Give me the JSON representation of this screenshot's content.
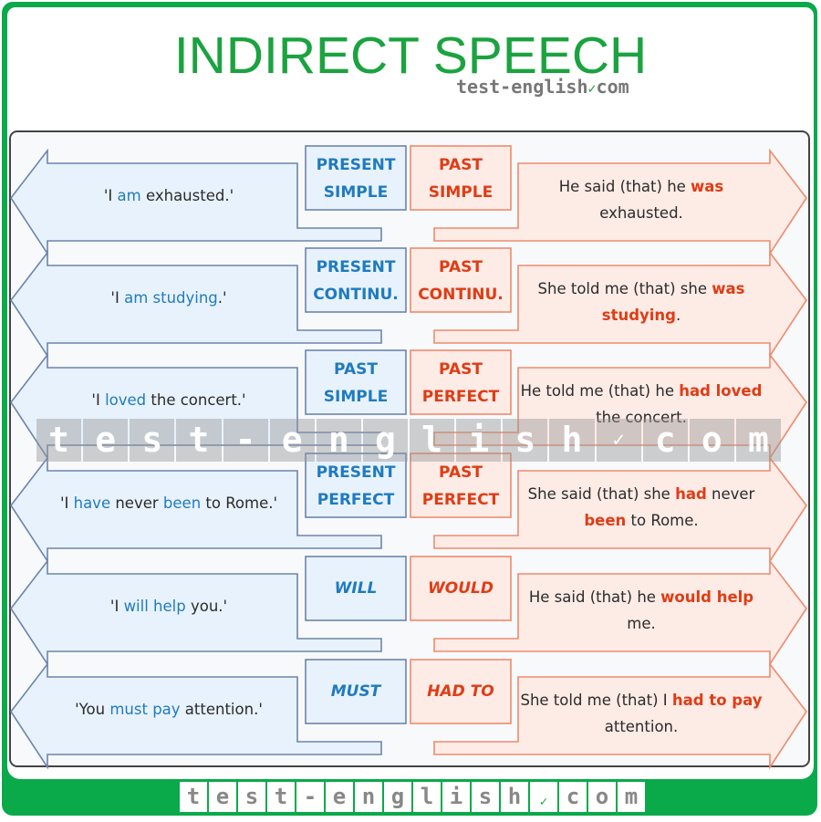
{
  "title": "INDIRECT SPEECH",
  "brand": {
    "text": "test-english",
    "suffix": "com",
    "check_icon": "check-circle-icon"
  },
  "colors": {
    "green": "#0aa94a",
    "blue": "#1f7bbf",
    "red": "#e03c14",
    "blue_fill": "#e8f2fc",
    "red_fill": "#fdebe6"
  },
  "rows": [
    {
      "direct": [
        {
          "t": "'I "
        },
        {
          "t": "am",
          "h": 1
        },
        {
          "t": " exhausted.'"
        }
      ],
      "tense_direct": [
        "PRESENT",
        "SIMPLE"
      ],
      "tense_reported": [
        "PAST",
        "SIMPLE"
      ],
      "reported": [
        {
          "t": "He said (that) he "
        },
        {
          "t": "was",
          "h": 1
        },
        {
          "t": " exhausted."
        }
      ]
    },
    {
      "direct": [
        {
          "t": "'I "
        },
        {
          "t": "am studying",
          "h": 1
        },
        {
          "t": ".'"
        }
      ],
      "tense_direct": [
        "PRESENT",
        "CONTINU."
      ],
      "tense_reported": [
        "PAST",
        "CONTINU."
      ],
      "reported": [
        {
          "t": "She told me (that) she "
        },
        {
          "t": "was studying",
          "h": 1
        },
        {
          "t": "."
        }
      ]
    },
    {
      "direct": [
        {
          "t": "'I "
        },
        {
          "t": "loved",
          "h": 1
        },
        {
          "t": " the concert.'"
        }
      ],
      "tense_direct": [
        "PAST",
        "SIMPLE"
      ],
      "tense_reported": [
        "PAST",
        "PERFECT"
      ],
      "reported": [
        {
          "t": "He told me (that) he "
        },
        {
          "t": "had loved",
          "h": 1
        },
        {
          "t": " the concert."
        }
      ]
    },
    {
      "direct": [
        {
          "t": "'I "
        },
        {
          "t": "have",
          "h": 1
        },
        {
          "t": " never "
        },
        {
          "t": "been",
          "h": 1
        },
        {
          "t": " to Rome.'"
        }
      ],
      "tense_direct": [
        "PRESENT",
        "PERFECT"
      ],
      "tense_reported": [
        "PAST",
        "PERFECT"
      ],
      "reported": [
        {
          "t": "She said (that) she "
        },
        {
          "t": "had",
          "h": 1
        },
        {
          "t": " never "
        },
        {
          "t": "been",
          "h": 1
        },
        {
          "t": " to Rome."
        }
      ]
    },
    {
      "direct": [
        {
          "t": "'I "
        },
        {
          "t": "will help",
          "h": 1
        },
        {
          "t": " you.'"
        }
      ],
      "tense_direct": [
        "WILL"
      ],
      "tense_reported": [
        "WOULD"
      ],
      "italic": true,
      "reported": [
        {
          "t": "He said (that) he "
        },
        {
          "t": "would help",
          "h": 1
        },
        {
          "t": " me."
        }
      ]
    },
    {
      "direct": [
        {
          "t": "'You "
        },
        {
          "t": "must pay",
          "h": 1
        },
        {
          "t": " attention.'"
        }
      ],
      "tense_direct": [
        "MUST"
      ],
      "tense_reported": [
        "HAD TO"
      ],
      "italic": true,
      "reported": [
        {
          "t": "She told me (that) I "
        },
        {
          "t": "had to pay",
          "h": 1
        },
        {
          "t": " attention."
        }
      ]
    }
  ],
  "watermark": [
    "t",
    "e",
    "s",
    "t",
    "-",
    "e",
    "n",
    "g",
    "l",
    "i",
    "s",
    "h",
    "✓",
    "c",
    "o",
    "m"
  ],
  "footer": [
    "t",
    "e",
    "s",
    "t",
    "-",
    "e",
    "n",
    "g",
    "l",
    "i",
    "s",
    "h",
    "✓",
    "c",
    "o",
    "m"
  ]
}
